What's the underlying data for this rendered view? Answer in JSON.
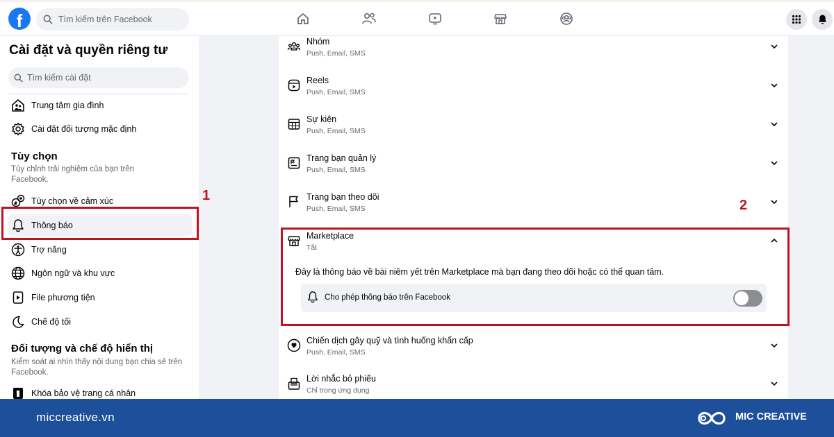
{
  "topbar": {
    "logo_letter": "f",
    "search_placeholder": "Tìm kiếm trên Facebook",
    "nav_icons": [
      "home-icon",
      "friends-icon",
      "video-icon",
      "marketplace-icon",
      "groups-icon"
    ],
    "right_icons": [
      "menu-grid-icon",
      "notifications-bell-icon"
    ]
  },
  "sidebar": {
    "title": "Cài đặt và quyền riêng tư",
    "search_placeholder": "Tìm kiếm cài đặt",
    "top_items": [
      {
        "label": "Trung tâm gia đình",
        "icon": "family-center-icon"
      },
      {
        "label": "Cài đặt đối tượng mặc định",
        "icon": "gear-icon"
      }
    ],
    "section_preferences": {
      "title": "Tùy chọn",
      "description": "Tùy chỉnh trải nghiệm của bạn trên Facebook."
    },
    "preference_items": [
      {
        "label": "Tùy chọn về cảm xúc",
        "icon": "reactions-icon"
      },
      {
        "label": "Thông báo",
        "icon": "bell-icon",
        "active": true
      },
      {
        "label": "Trợ năng",
        "icon": "accessibility-icon"
      },
      {
        "label": "Ngôn ngữ và khu vực",
        "icon": "globe-icon"
      },
      {
        "label": "File phương tiện",
        "icon": "media-file-icon"
      },
      {
        "label": "Chế độ tối",
        "icon": "moon-icon"
      }
    ],
    "section_audience": {
      "title": "Đối tượng và chế độ hiển thị",
      "description": "Kiểm soát ai nhìn thấy nội dung bạn chia sẻ trên Facebook."
    },
    "audience_items": [
      {
        "label": "Khóa bảo vệ trang cá nhân",
        "icon": "profile-lock-icon"
      }
    ]
  },
  "annotations": {
    "marker_1": "1",
    "marker_2": "2",
    "highlight_color": "#c1121f"
  },
  "notifications": {
    "rows": [
      {
        "title": "Nhóm",
        "subtitle": "Push, Email, SMS",
        "icon": "groups-icon"
      },
      {
        "title": "Reels",
        "subtitle": "Push, Email, SMS",
        "icon": "reels-icon"
      },
      {
        "title": "Sự kiện",
        "subtitle": "Push, Email, SMS",
        "icon": "calendar-icon"
      },
      {
        "title": "Trang bạn quản lý",
        "subtitle": "Push, Email, SMS",
        "icon": "managed-pages-icon"
      },
      {
        "title": "Trang bạn theo dõi",
        "subtitle": "Push, Email, SMS",
        "icon": "flag-icon"
      },
      {
        "title": "Marketplace",
        "subtitle": "Tắt",
        "icon": "marketplace-icon",
        "expanded": true
      },
      {
        "title": "Chiến dịch gây quỹ và tình huống khẩn cấp",
        "subtitle": "Push, Email, SMS",
        "icon": "fundraiser-icon"
      },
      {
        "title": "Lời nhắc bỏ phiếu",
        "subtitle": "Chỉ trong ứng dụng",
        "icon": "ballot-box-icon"
      }
    ],
    "marketplace_description": "Đây là thông báo về bài niêm yết trên Marketplace mà bạn đang theo dõi hoặc có thể quan tâm.",
    "toggle_label": "Cho phép thông báo trên Facebook",
    "toggle_on": false
  },
  "footer": {
    "website": "miccreative.vn",
    "brand": "MIC CREATIVE",
    "background_color": "#1e4f9a"
  }
}
